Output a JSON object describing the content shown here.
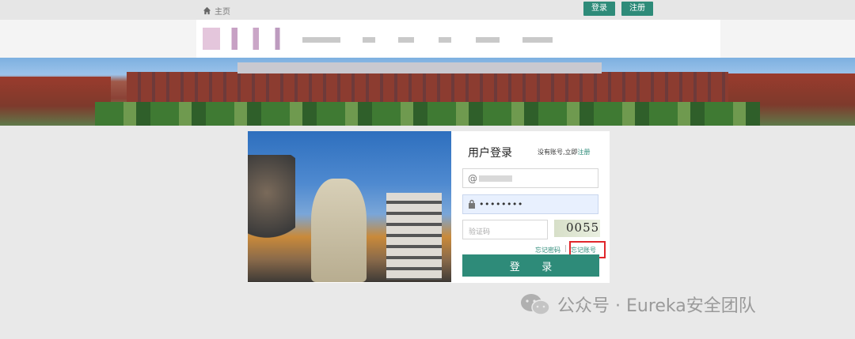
{
  "topbar": {
    "home_label": "主页",
    "login_label": "登录",
    "register_label": "注册"
  },
  "login_panel": {
    "title": "用户登录",
    "register_prompt": "没有账号,立即",
    "register_link": "注册",
    "username": {
      "icon": "at-icon",
      "value_obscured": true
    },
    "password": {
      "icon": "lock-icon",
      "value": "••••••••"
    },
    "captcha_field": {
      "placeholder": "验证码"
    },
    "captcha_image_text": "0055",
    "forgot_password": "忘记密码",
    "separator": "|",
    "forgot_account": "忘记账号",
    "submit_label": "登 录"
  },
  "watermark": {
    "text": "公众号 · Eureka安全团队",
    "icon": "wechat-icon"
  },
  "colors": {
    "accent": "#2e8b79",
    "highlight_box": "#e0262b",
    "background": "#e9e9e9"
  }
}
